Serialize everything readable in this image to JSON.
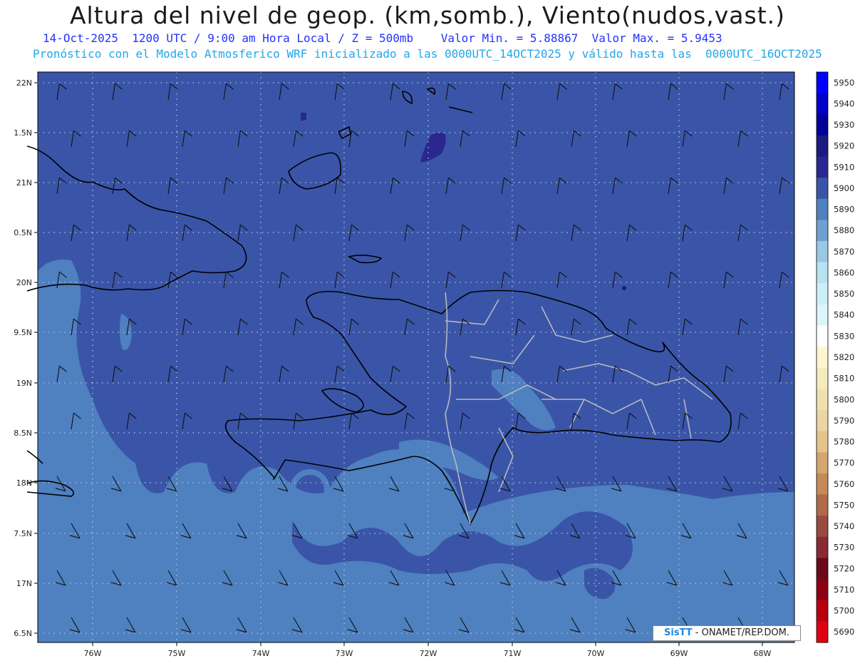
{
  "title": "Altura del nivel de geop. (km,somb.), Viento(nudos,vast.)",
  "subtitle_line1": "14-Oct-2025  1200 UTC / 9:00 am Hora Local / Z = 500mb    Valor Min. = 5.88867  Valor Max. = 5.9453",
  "subtitle_line2": "Pronóstico con el Modelo Atmosferico WRF inicializado a las 0000UTC_14OCT2025 y válido hasta las  0000UTC_16OCT2025",
  "credit": {
    "logo": "SisTT",
    "text": " - ONAMET/REP.DOM."
  },
  "lat_labels": [
    "22N",
    "1.5N",
    "21N",
    "0.5N",
    "20N",
    "9.5N",
    "19N",
    "8.5N",
    "18N",
    "7.5N",
    "17N",
    "6.5N"
  ],
  "lon_labels": [
    "76W",
    "75W",
    "74W",
    "73W",
    "72W",
    "71W",
    "70W",
    "69W",
    "68W"
  ],
  "colorbar": {
    "levels": [
      "5950",
      "5940",
      "5930",
      "5920",
      "5910",
      "5900",
      "5890",
      "5880",
      "5870",
      "5860",
      "5850",
      "5840",
      "5830",
      "5820",
      "5810",
      "5800",
      "5790",
      "5780",
      "5770",
      "5760",
      "5750",
      "5740",
      "5730",
      "5720",
      "5710",
      "5700",
      "5690"
    ],
    "colors": [
      "#0000ff",
      "#0000cc",
      "#00009a",
      "#1a1a80",
      "#2a2890",
      "#3a55a8",
      "#4f80c0",
      "#6fa0d0",
      "#9ac8e4",
      "#b8e2f0",
      "#cdeef6",
      "#dcf4fa",
      "#ffffff",
      "#fff6d0",
      "#f6ebbf",
      "#f0e0b0",
      "#ebd6a2",
      "#e2c48c",
      "#d4a66e",
      "#c48a58",
      "#b06a48",
      "#9a4a3e",
      "#8a2a34",
      "#6a0a1a",
      "#8c0014",
      "#b80010",
      "#e00010"
    ]
  },
  "map_colors": {
    "base": "#3a55a8",
    "light": "#4f80c0",
    "lighter": "#6fa0d0",
    "dark": "#2a2890"
  }
}
